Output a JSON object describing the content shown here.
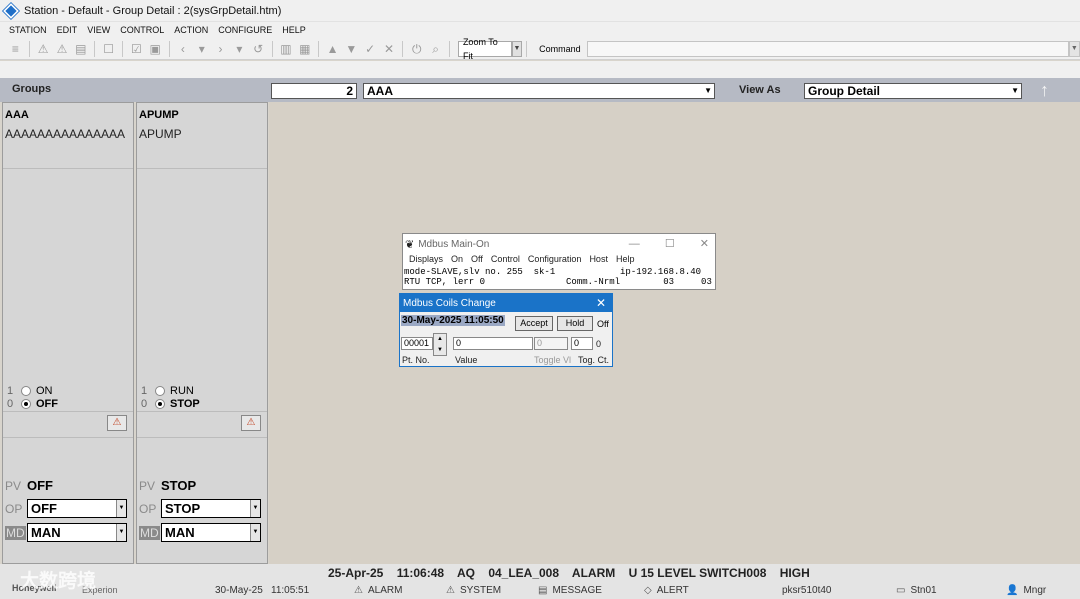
{
  "window": {
    "title": "Station - Default - Group Detail : 2(sysGrpDetail.htm)"
  },
  "menu": [
    "STATION",
    "EDIT",
    "VIEW",
    "CONTROL",
    "ACTION",
    "CONFIGURE",
    "HELP"
  ],
  "toolbar": {
    "zoom": "Zoom To Fit",
    "command_label": "Command",
    "command_value": ""
  },
  "header": {
    "groups_label": "Groups",
    "group_number": "2",
    "group_name": "AAA",
    "view_as_label": "View As",
    "view_as_value": "Group Detail"
  },
  "faceplates": [
    {
      "tag": "AAA",
      "desc": "AAAAAAAAAAAAAAA",
      "states": [
        {
          "num": "1",
          "label": "ON"
        },
        {
          "num": "0",
          "label": "OFF"
        }
      ],
      "pv_label": "PV",
      "pv": "OFF",
      "op_label": "OP",
      "op": "OFF",
      "md_label": "MD",
      "md": "MAN"
    },
    {
      "tag": "APUMP",
      "desc": "APUMP",
      "states": [
        {
          "num": "1",
          "label": "RUN"
        },
        {
          "num": "0",
          "label": "STOP"
        }
      ],
      "pv_label": "PV",
      "pv": "STOP",
      "op_label": "OP",
      "op": "STOP",
      "md_label": "MD",
      "md": "MAN"
    }
  ],
  "mdbus_main": {
    "title": "Mdbus Main-On",
    "menu": [
      "Displays",
      "On",
      "Off",
      "Control",
      "Configuration",
      "Host",
      "Help"
    ],
    "line1": "mode-SLAVE,slv no. 255  sk-1            ip-192.168.8.40",
    "line2": "RTU TCP, lerr 0               Comm.-Nrml        03     03"
  },
  "coils": {
    "title": "Mdbus Coils Change",
    "datetime": "30-May-2025 11:05:50",
    "accept": "Accept",
    "hold": "Hold",
    "off": "Off",
    "pt_no": "00001",
    "value": "0",
    "toggle_value": "0",
    "tog_ct": "0",
    "tog_ct_value": "0",
    "labels": {
      "pt_no": "Pt. No.",
      "value": "Value",
      "toggle": "Toggle Vl",
      "tog_ct": "Tog. Ct."
    }
  },
  "alarm": {
    "date": "25-Apr-25",
    "time": "11:06:48",
    "area": "AQ",
    "tag": "04_LEA_008",
    "type": "ALARM",
    "desc": "U 15 LEVEL SWITCH008",
    "priority": "HIGH"
  },
  "status": {
    "brand": "Honeywell",
    "product": "Experion",
    "date": "30-May-25",
    "time": "11:05:51",
    "alarm": "ALARM",
    "system": "SYSTEM",
    "message": "MESSAGE",
    "alert": "ALERT",
    "server": "pksr510t40",
    "station": "Stn01",
    "user": "Mngr"
  },
  "watermark": "大数跨境"
}
